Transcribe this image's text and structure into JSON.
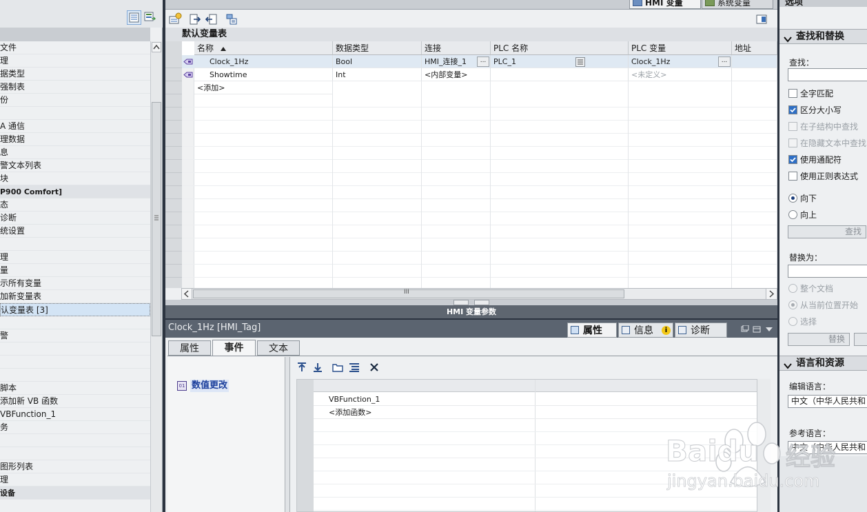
{
  "left_panel": {
    "items": [
      {
        "label": "文件",
        "style": "normal"
      },
      {
        "label": "理",
        "style": "normal"
      },
      {
        "label": "据类型",
        "style": "normal"
      },
      {
        "label": "强制表",
        "style": "normal"
      },
      {
        "label": "份",
        "style": "normal"
      },
      {
        "label": "",
        "style": "normal"
      },
      {
        "label": "A 通信",
        "style": "normal"
      },
      {
        "label": "理数据",
        "style": "normal"
      },
      {
        "label": "息",
        "style": "normal"
      },
      {
        "label": "警文本列表",
        "style": "normal"
      },
      {
        "label": "块",
        "style": "normal"
      },
      {
        "label": "P900 Comfort]",
        "style": "bold"
      },
      {
        "label": "态",
        "style": "normal"
      },
      {
        "label": "诊断",
        "style": "normal"
      },
      {
        "label": "统设置",
        "style": "normal"
      },
      {
        "label": "",
        "style": "normal"
      },
      {
        "label": "理",
        "style": "normal"
      },
      {
        "label": "量",
        "style": "normal"
      },
      {
        "label": "示所有变量",
        "style": "normal"
      },
      {
        "label": "加新变量表",
        "style": "normal"
      },
      {
        "label": "认变量表 [3]",
        "style": "selected"
      },
      {
        "label": "",
        "style": "normal"
      },
      {
        "label": "警",
        "style": "normal"
      },
      {
        "label": "",
        "style": "normal"
      },
      {
        "label": "",
        "style": "normal"
      },
      {
        "label": "",
        "style": "normal"
      },
      {
        "label": "脚本",
        "style": "normal"
      },
      {
        "label": "添加新 VB 函数",
        "style": "normal"
      },
      {
        "label": "VBFunction_1",
        "style": "normal"
      },
      {
        "label": "务",
        "style": "normal"
      },
      {
        "label": "",
        "style": "normal"
      },
      {
        "label": "",
        "style": "normal"
      },
      {
        "label": "图形列表",
        "style": "normal"
      },
      {
        "label": "理",
        "style": "normal"
      },
      {
        "label": "设备",
        "style": "bold"
      }
    ]
  },
  "top_tabs": {
    "hmi_tags": "HMI 变量",
    "system_tags": "系统变量"
  },
  "tag_table": {
    "title": "默认变量表",
    "columns": [
      "名称",
      "数据类型",
      "连接",
      "PLC 名称",
      "PLC 变量",
      "地址"
    ],
    "rows": [
      {
        "name": "Clock_1Hz",
        "type": "Bool",
        "connection": "HMI_连接_1",
        "plc_name": "PLC_1",
        "plc_tag": "Clock_1Hz",
        "address": ""
      },
      {
        "name": "Showtime",
        "type": "Int",
        "connection": "<内部变量>",
        "plc_name": "",
        "plc_tag": "<未定义>",
        "address": ""
      }
    ],
    "add_row": "<添加>",
    "ellipsis": "...",
    "scroll_grip": "III"
  },
  "params_bar": "HMI 变量参数",
  "inspector": {
    "title": "Clock_1Hz [HMI_Tag]",
    "tabs": [
      "属性",
      "信息",
      "诊断"
    ],
    "info_badge": "i",
    "sub_tabs": [
      "属性",
      "事件",
      "文本"
    ],
    "event": "数值更改",
    "functions": [
      "VBFunction_1",
      "<添加函数>"
    ]
  },
  "task_panel": {
    "header": "选项",
    "find_section": "查找和替换",
    "find_label": "查找：",
    "find_value": "",
    "options": [
      {
        "label": "全字匹配",
        "checked": false,
        "enabled": true
      },
      {
        "label": "区分大小写",
        "checked": true,
        "enabled": true
      },
      {
        "label": "在子结构中查找",
        "checked": false,
        "enabled": false
      },
      {
        "label": "在隐藏文本中查找",
        "checked": false,
        "enabled": false
      },
      {
        "label": "使用通配符",
        "checked": true,
        "enabled": true
      },
      {
        "label": "使用正则表达式",
        "checked": false,
        "enabled": true
      }
    ],
    "direction": [
      {
        "label": "向下",
        "selected": true
      },
      {
        "label": "向上",
        "selected": false
      }
    ],
    "find_button": "查找",
    "replace_label": "替换为：",
    "replace_value": "",
    "replace_scope": [
      {
        "label": "整个文档",
        "selected": false
      },
      {
        "label": "从当前位置开始",
        "selected": true
      },
      {
        "label": "选择",
        "selected": false
      }
    ],
    "replace_button": "替换",
    "lang_section": "语言和资源",
    "edit_lang_label": "编辑语言：",
    "edit_lang_value": "中文（中华人民共和",
    "ref_lang_label": "参考语言：",
    "ref_lang_value": "中文（中华人民共和"
  },
  "watermark": {
    "brand": "Baidu",
    "brand_cn": "经验",
    "url": "jingyan.baidu.com"
  },
  "colors": {
    "accent": "#2a6fd6",
    "dark_bar": "#5b6470",
    "check_blue": "#2e6fc5"
  }
}
